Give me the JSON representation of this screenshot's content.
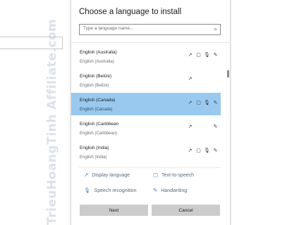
{
  "watermark": "TrieuHoangTinh Affiliate.com",
  "dialog": {
    "title": "Choose a language to install",
    "search_placeholder": "Type a language name..."
  },
  "languages": [
    {
      "name": "English (Australia)",
      "sub": "English (Australia)",
      "features": [
        "display-language-icon",
        "text-to-speech-icon",
        "speech-recognition-icon",
        "handwriting-icon"
      ],
      "selected": false
    },
    {
      "name": "English (Belize)",
      "sub": "English (Belize)",
      "features": [
        "display-language-icon",
        "",
        "",
        ""
      ],
      "selected": false
    },
    {
      "name": "English (Canada)",
      "sub": "English (Canada)",
      "features": [
        "display-language-icon",
        "text-to-speech-icon",
        "speech-recognition-icon",
        "handwriting-icon"
      ],
      "selected": true
    },
    {
      "name": "English (Caribbean",
      "sub": "English (Caribbean)",
      "features": [
        "display-language-icon",
        "",
        "",
        "handwriting-icon"
      ],
      "selected": false
    },
    {
      "name": "English (India)",
      "sub": "English (India)",
      "features": [
        "display-language-icon",
        "text-to-speech-icon",
        "speech-recognition-icon",
        "handwriting-icon"
      ],
      "selected": false
    }
  ],
  "legend": {
    "display_language": "Display language",
    "text_to_speech": "Text-to-speech",
    "speech_recognition": "Speech recognition",
    "handwriting": "Handwriting"
  },
  "buttons": {
    "next": "Next",
    "cancel": "Cancel"
  },
  "colors": {
    "selected_row": "#99c9ef",
    "button": "#cccccc",
    "legend_icon": "#3d7fc0"
  }
}
